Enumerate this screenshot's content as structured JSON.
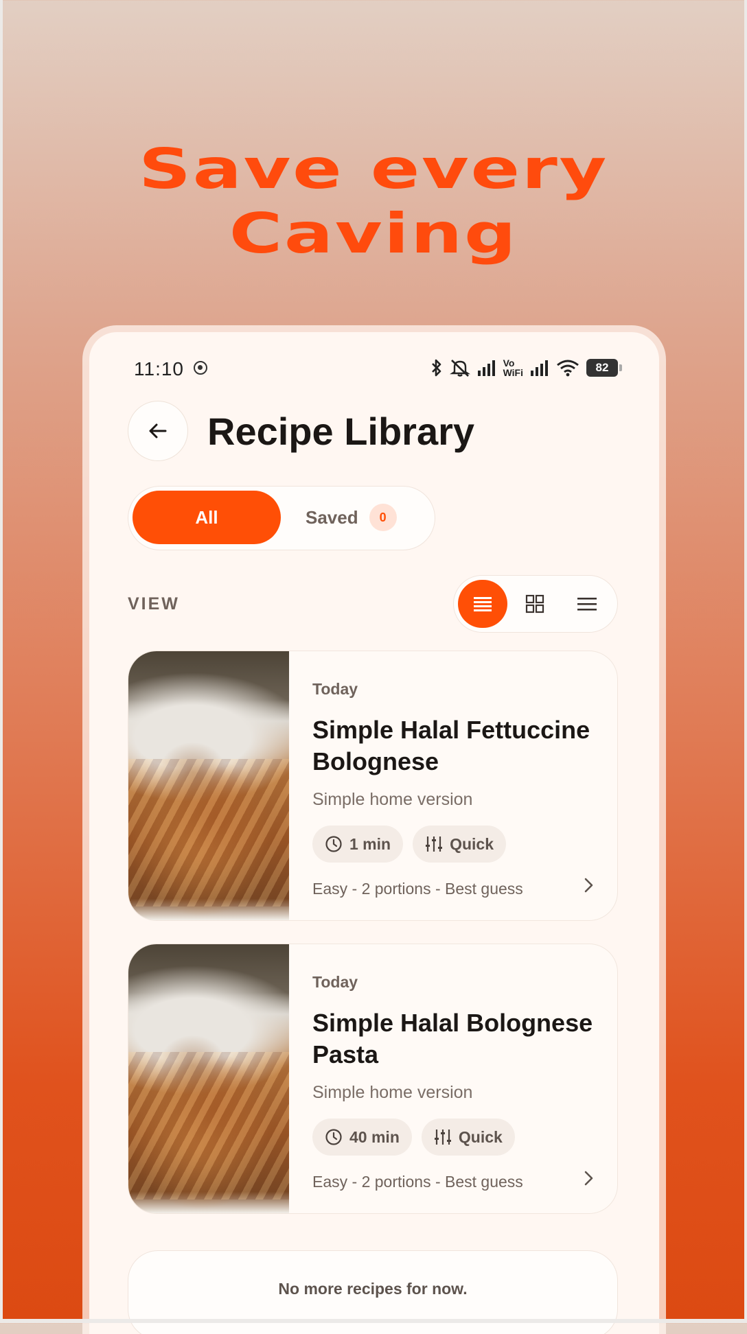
{
  "headline": {
    "line1": "Save every",
    "line2": "Caving"
  },
  "statusbar": {
    "time": "11:10",
    "volte_top": "Vo",
    "volte_bottom": "WiFi",
    "battery": "82"
  },
  "header": {
    "title": "Recipe Library"
  },
  "tabs": {
    "all_label": "All",
    "saved_label": "Saved",
    "saved_count": "0"
  },
  "view": {
    "label": "VIEW",
    "active": "list-large",
    "options": [
      "list-large",
      "grid",
      "list-compact"
    ]
  },
  "recipes": [
    {
      "date": "Today",
      "title": "Simple Halal Fettuccine Bolognese",
      "subtitle": "Simple home version",
      "time": "1 min",
      "tag": "Quick",
      "meta": "Easy - 2 portions - Best guess"
    },
    {
      "date": "Today",
      "title": "Simple Halal Bolognese Pasta",
      "subtitle": "Simple home version",
      "time": "40 min",
      "tag": "Quick",
      "meta": "Easy - 2 portions - Best guess"
    }
  ],
  "footer": {
    "end_message": "No more recipes for now."
  },
  "colors": {
    "accent": "#ff4f06",
    "headline": "#ff4b0d",
    "surface": "#fff7f2",
    "text": "#1b1715"
  }
}
